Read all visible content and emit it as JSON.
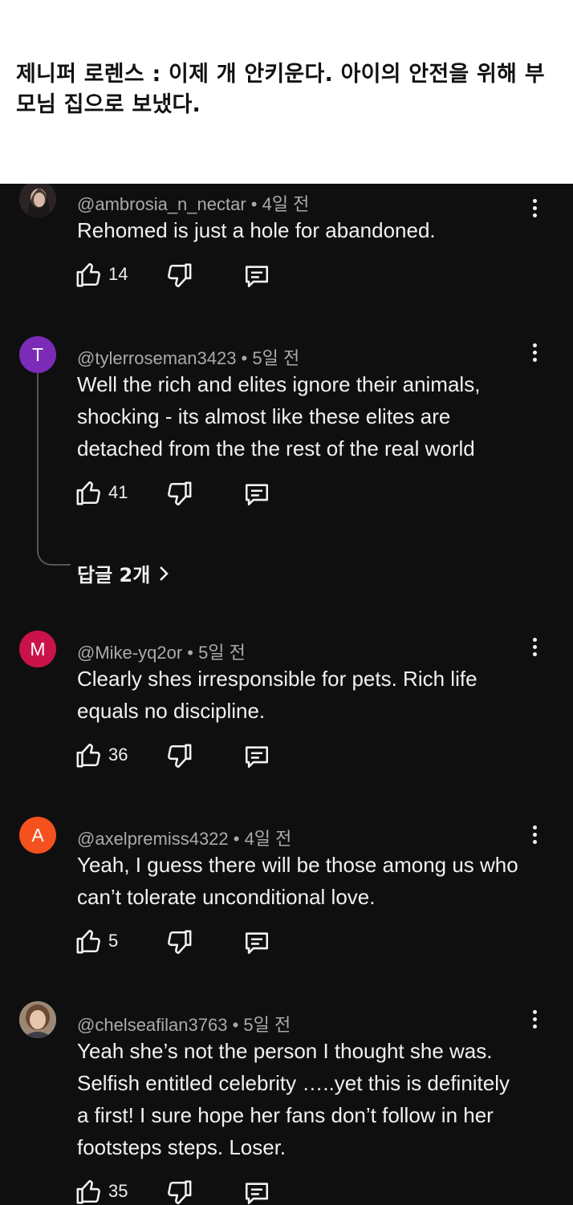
{
  "header": {
    "title": "제니퍼 로렌스 : 이제 개 안키운다. 아이의 안전을 위해 부모님 집으로 보냈다."
  },
  "colors": {
    "background": "#0f0f0f",
    "text": "#f1f1f1",
    "meta": "#aaaaaa",
    "avatar_T": "#7b2bb8",
    "avatar_M": "#c9124a",
    "avatar_A": "#f4511e"
  },
  "icons": {
    "like": "thumbs-up-icon",
    "dislike": "thumbs-down-icon",
    "reply": "comment-icon",
    "menu": "more-vertical-icon"
  },
  "comments": [
    {
      "author": "@ambrosia_n_nectar",
      "time": "4일 전",
      "meta": "@ambrosia_n_nectar • 4일 전",
      "avatar_initial": "",
      "text": "Rehomed is just a hole for abandoned.",
      "likes": "14"
    },
    {
      "author": "@tylerroseman3423",
      "time": "5일 전",
      "meta": "@tylerroseman3423 • 5일 전",
      "avatar_initial": "T",
      "text": "Well the rich and elites ignore their animals, shocking - its almost like these elites are detached from the the rest of the real world",
      "likes": "41",
      "replies_label": "답글 2개"
    },
    {
      "author": "@Mike-yq2or",
      "time": "5일 전",
      "meta": "@Mike-yq2or • 5일 전",
      "avatar_initial": "M",
      "text": "Clearly shes irresponsible for pets. Rich life equals no discipline.",
      "likes": "36"
    },
    {
      "author": "@axelpremiss4322",
      "time": "4일 전",
      "meta": "@axelpremiss4322 • 4일 전",
      "avatar_initial": "A",
      "text": "Yeah, I guess there will be those among us who can’t tolerate unconditional love.",
      "likes": "5"
    },
    {
      "author": "@chelseafilan3763",
      "time": "5일 전",
      "meta": "@chelseafilan3763 • 5일 전",
      "avatar_initial": "",
      "text": "Yeah she’s not the person I thought she was. Selfish entitled celebrity …..yet this is definitely a first! I sure hope her fans don’t follow in her footsteps steps.  Loser.",
      "likes": "35"
    }
  ]
}
